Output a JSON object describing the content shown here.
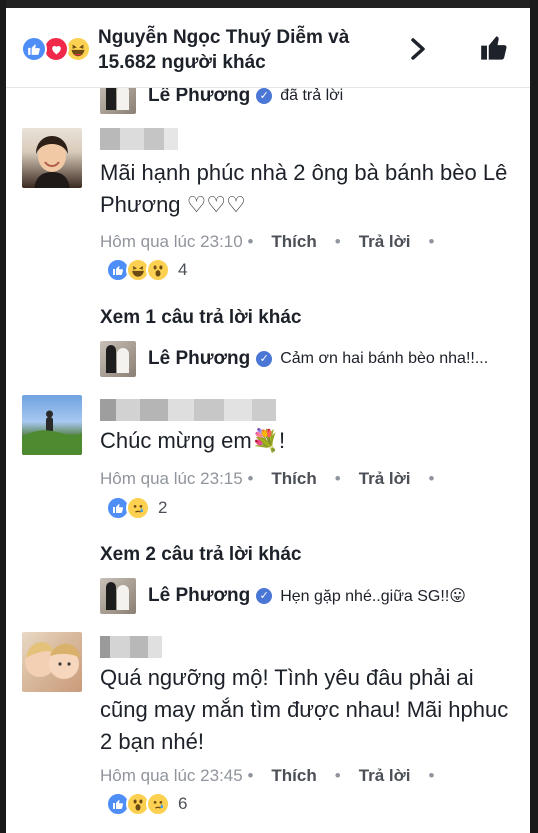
{
  "header": {
    "summary": "Nguyễn Ngọc Thuý Diễm và 15.682 người khác",
    "reactions": [
      "like-icon",
      "love-icon",
      "haha-icon"
    ]
  },
  "partial_reply": {
    "name": "Lê Phương",
    "text": "đã trả lời"
  },
  "comments": [
    {
      "text": "Mãi hạnh phúc nhà 2 ông bà bánh bèo Lê Phương ♡♡♡",
      "time": "Hôm qua lúc 23:10",
      "like_label": "Thích",
      "reply_label": "Trả lời",
      "reactions": [
        "like-icon",
        "haha-icon",
        "wow-icon"
      ],
      "reaction_count": "4",
      "see_more": "Xem 1 câu trả lời khác",
      "reply": {
        "name": "Lê Phương",
        "text": "Cảm ơn hai bánh bèo nha!!..."
      }
    },
    {
      "text": "Chúc mừng em💐!",
      "time": "Hôm qua lúc 23:15",
      "like_label": "Thích",
      "reply_label": "Trả lời",
      "reactions": [
        "like-icon",
        "sad-icon"
      ],
      "reaction_count": "2",
      "see_more": "Xem 2 câu trả lời khác",
      "reply": {
        "name": "Lê Phương",
        "text": "Hẹn gặp nhé..giữa SG!!😛"
      }
    },
    {
      "text": "Quá ngưỡng mộ! Tình yêu đâu phải ai cũng may mắn tìm được nhau! Mãi hphuc 2 bạn nhé!",
      "time": "Hôm qua lúc 23:45",
      "like_label": "Thích",
      "reply_label": "Trả lời",
      "reactions": [
        "like-icon",
        "wow-icon",
        "sad-icon"
      ],
      "reaction_count": "6"
    }
  ],
  "colors": {
    "like": "#4f8ef7",
    "love": "#f0284a",
    "emoji": "#fcd050",
    "meta_text": "#90949c",
    "verified": "#4a76d6"
  }
}
